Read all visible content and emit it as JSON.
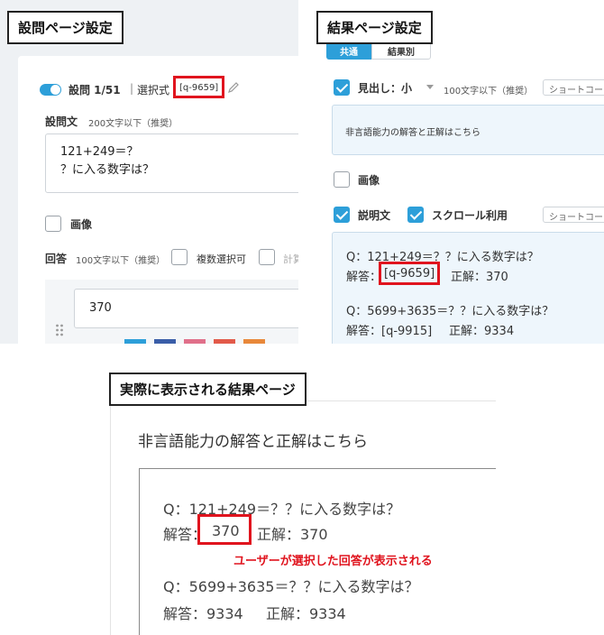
{
  "labels": {
    "question_settings": "設問ページ設定",
    "result_settings": "結果ページ設定",
    "actual_result": "実際に表示される結果ページ"
  },
  "question_panel": {
    "question_number": "設問 1/51",
    "separator": "|",
    "question_type": "選択式",
    "question_id": "[q-9659]",
    "question_text_label": "設問文",
    "question_text_limit": "200文字以下（推奨）",
    "question_text_line1": "121+249＝？",
    "question_text_line2": "？に入る数字は？",
    "image_label": "画像",
    "answer_label": "回答",
    "answer_limit": "100文字以下（推奨）",
    "multi_select_label": "複数選択可",
    "calc_label": "計算",
    "answer_value": "370",
    "swatch_colors": [
      "#2d9fd9",
      "#3a5ea8",
      "#e0708a",
      "#e25a4a",
      "#e8883a"
    ]
  },
  "result_panel": {
    "tab_common": "共通",
    "tab_by_result": "結果別",
    "heading_label": "見出し：小",
    "heading_limit": "100文字以下（推奨）",
    "shortcode_label": "ショートコー",
    "heading_text": "非言語能力の解答と正解はこちら",
    "image_label": "画像",
    "description_label": "説明文",
    "scroll_label": "スクロール利用",
    "shortcode_label2": "ショートコー",
    "q1_line": "Q：121+249＝？？に入る数字は？",
    "q1_answer_prefix": "解答：",
    "q1_answer_code": "[q-9659]",
    "q1_correct": "正解：370",
    "q2_line": "Q：5699+3635＝？？に入る数字は？",
    "q2_answer": "解答：[q-9915]",
    "q2_correct": "正解：9334"
  },
  "actual_panel": {
    "heading": "非言語能力の解答と正解はこちら",
    "q1_line": "Q：121+249＝？？に入る数字は？",
    "q1_answer_prefix": "解答：",
    "q1_answer_value": "370",
    "q1_correct": "正解：370",
    "annotation": "ユーザーが選択した回答が表示される",
    "q2_line": "Q：5699+3635＝？？に入る数字は？",
    "q2_answer": "解答：9334",
    "q2_correct": "正解：9334"
  },
  "colors": {
    "accent_blue": "#2d9fd9",
    "highlight_red": "#e0141e"
  }
}
